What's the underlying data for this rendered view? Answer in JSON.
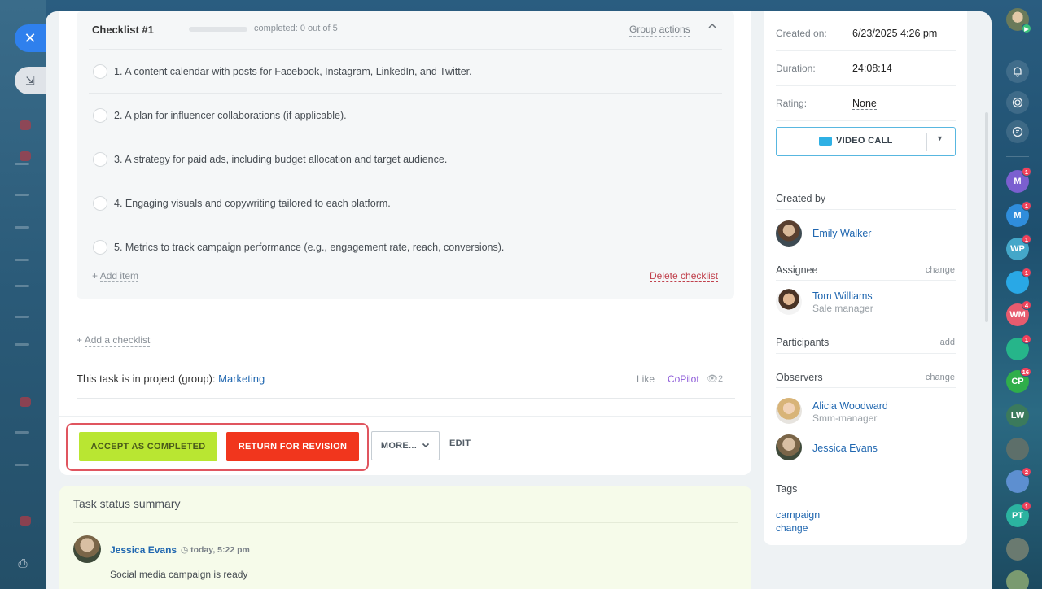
{
  "nav": {
    "close_icon": "close-icon",
    "minimize_icon": "minimize-icon",
    "print_icon": "printer-icon"
  },
  "checklist": {
    "title": "Checklist #1",
    "progress_text": "completed: 0 out of 5",
    "progress_fraction": 0,
    "group_actions": "Group actions",
    "items": [
      {
        "text": "1. A content calendar with posts for Facebook, Instagram, LinkedIn, and Twitter."
      },
      {
        "text": "2. A plan for influencer collaborations (if applicable)."
      },
      {
        "text": "3. A strategy for paid ads, including budget allocation and target audience."
      },
      {
        "text": "4. Engaging visuals and copywriting tailored to each platform."
      },
      {
        "text": "5. Metrics to track campaign performance (e.g., engagement rate, reach, conversions)."
      }
    ],
    "add_item": "Add item",
    "delete": "Delete checklist"
  },
  "add_checklist": "Add a checklist",
  "project": {
    "prefix": "This task is in project (group):",
    "name": "Marketing"
  },
  "meta": {
    "like": "Like",
    "copilot": "CoPilot",
    "views": "2"
  },
  "actions": {
    "accept": "ACCEPT AS COMPLETED",
    "return": "RETURN FOR REVISION",
    "more": "MORE...",
    "edit": "EDIT"
  },
  "summary": {
    "title": "Task status summary",
    "author": "Jessica Evans",
    "time": "today, 5:22 pm",
    "text": "Social media campaign is ready"
  },
  "sidebar": {
    "created_on_label": "Created on:",
    "created_on_value": "6/23/2025 4:26 pm",
    "duration_label": "Duration:",
    "duration_value": "24:08:14",
    "rating_label": "Rating:",
    "rating_value": "None",
    "video_call": "VIDEO CALL",
    "created_by_title": "Created by",
    "created_by": {
      "name": "Emily Walker"
    },
    "assignee_title": "Assignee",
    "assignee_action": "change",
    "assignee": {
      "name": "Tom Williams",
      "role": "Sale manager"
    },
    "participants_title": "Participants",
    "participants_action": "add",
    "observers_title": "Observers",
    "observers_action": "change",
    "observers": [
      {
        "name": "Alicia Woodward",
        "role": "Smm-manager"
      },
      {
        "name": "Jessica Evans",
        "role": ""
      }
    ],
    "tags_title": "Tags",
    "tag": "campaign",
    "tag_change": "change"
  },
  "rail": {
    "items": [
      {
        "initials": "M",
        "badge": "1",
        "color": "#7b5fd0"
      },
      {
        "initials": "M",
        "badge": "1",
        "color": "#2f8ddc"
      },
      {
        "initials": "WP",
        "badge": "1",
        "color": "#44a7c9"
      },
      {
        "initials": "",
        "badge": "1",
        "color": "#29a8e6"
      },
      {
        "initials": "WM",
        "badge": "4",
        "color": "#e75b6e"
      },
      {
        "initials": "",
        "badge": "1",
        "color": "#26b58a"
      },
      {
        "initials": "CP",
        "badge": "16",
        "color": "#2fae4a"
      },
      {
        "initials": "LW",
        "badge": "",
        "color": "#3b7a5c"
      },
      {
        "initials": "",
        "badge": "",
        "color": "#5d6f6a"
      },
      {
        "initials": "",
        "badge": "2",
        "color": "#5d8fd0"
      },
      {
        "initials": "PT",
        "badge": "1",
        "color": "#2bb3a0"
      },
      {
        "initials": "",
        "badge": "",
        "color": "#6a7a70"
      },
      {
        "initials": "",
        "badge": "",
        "color": "#7a9a70"
      }
    ]
  }
}
